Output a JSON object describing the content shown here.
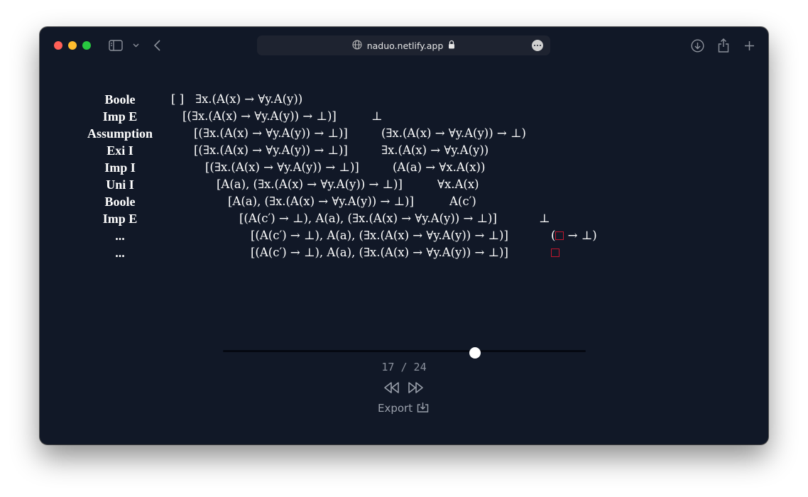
{
  "browser": {
    "url": "naduo.netlify.app",
    "icons": [
      "sidebar-icon",
      "chevron-down-icon",
      "back-icon",
      "globe-icon",
      "lock-icon",
      "more-icon",
      "download-icon",
      "share-icon",
      "new-tab-icon"
    ]
  },
  "proof": {
    "rows": [
      {
        "rule": "Boole",
        "context": "[ ]",
        "goal": "∃x.(A(x) → ∀y.A(y))"
      },
      {
        "rule": "Imp E",
        "context": "[(∃x.(A(x) → ∀y.A(y)) → ⊥)]",
        "goal": "⊥"
      },
      {
        "rule": "Assumption",
        "context": "[(∃x.(A(x) → ∀y.A(y)) → ⊥)]",
        "goal": "(∃x.(A(x) → ∀y.A(y)) → ⊥)"
      },
      {
        "rule": "Exi I",
        "context": "[(∃x.(A(x) → ∀y.A(y)) → ⊥)]",
        "goal": "∃x.(A(x) → ∀y.A(y))"
      },
      {
        "rule": "Imp I",
        "context": "[(∃x.(A(x) → ∀y.A(y)) → ⊥)]",
        "goal": "(A(a) → ∀x.A(x))"
      },
      {
        "rule": "Uni I",
        "context": "[A(a), (∃x.(A(x) → ∀y.A(y)) → ⊥)]",
        "goal": "∀x.A(x)"
      },
      {
        "rule": "Boole",
        "context": "[A(a), (∃x.(A(x) → ∀y.A(y)) → ⊥)]",
        "goal": "A(c′)"
      },
      {
        "rule": "Imp E",
        "context": "[(A(c′) → ⊥), A(a), (∃x.(A(x) → ∀y.A(y)) → ⊥)]",
        "goal": "⊥"
      },
      {
        "rule": "...",
        "context": "[(A(c′) → ⊥), A(a), (∃x.(A(x) → ∀y.A(y)) → ⊥)]",
        "goal_open": "(",
        "goal_close": " → ⊥)"
      },
      {
        "rule": "...",
        "context": "[(A(c′) → ⊥), A(a), (∃x.(A(x) → ∀y.A(y)) → ⊥)]",
        "goal_open": "",
        "goal_close": ""
      }
    ],
    "hole_color": "#c0162d"
  },
  "player": {
    "current": "17",
    "separator": "/",
    "total": "24",
    "progress": 0.694,
    "rewind_icon": "rewind-icon",
    "forward_icon": "fast-forward-icon",
    "export_label": "Export",
    "export_icon": "export-icon"
  },
  "colors": {
    "background": "#111827",
    "text": "#ffffff",
    "muted": "#8a909c"
  }
}
